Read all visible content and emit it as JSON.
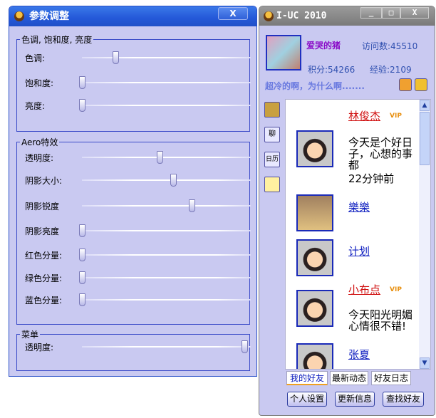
{
  "settings": {
    "title": "参数调整",
    "close": "X",
    "groups": [
      {
        "legend": "色调, 饱和度, 亮度",
        "sliders": [
          {
            "label": "色调:",
            "value": 0.2
          },
          {
            "label": "饱和度:",
            "value": 0
          },
          {
            "label": "亮度:",
            "value": 0
          }
        ]
      },
      {
        "legend": "Aero特效",
        "sliders": [
          {
            "label": "透明度:",
            "value": 0.46
          },
          {
            "label": "阴影大小:",
            "value": 0.54
          },
          {
            "label": "阴影锐度",
            "value": 0.65
          },
          {
            "label": "阴影亮度",
            "value": 0
          },
          {
            "label": "红色分量:",
            "value": 0
          },
          {
            "label": "绿色分量:",
            "value": 0
          },
          {
            "label": "蓝色分量:",
            "value": 0
          }
        ]
      },
      {
        "legend": "菜单",
        "sliders": [
          {
            "label": "透明度:",
            "value": 0.96
          }
        ]
      }
    ]
  },
  "main": {
    "title": "I-UC 2010",
    "minimize": "_",
    "maximize": "□",
    "close": "X",
    "username": "爱哭的猪",
    "visits": "访问数:45510",
    "points": "积分:54266",
    "exp": "经验:2109",
    "signature": "超冷的啊，为什么啊.......",
    "side_icons": [
      "聊",
      "日历"
    ],
    "friends": [
      {
        "name": "林俊杰",
        "vip": "VIP",
        "msg": "今天是个好日子，心想的事都",
        "time": "22分钟前"
      },
      {
        "name": "樂樂"
      },
      {
        "name": "计划"
      },
      {
        "name": "小布点",
        "vip": "VIP",
        "msg": "今天阳光明媚心情很不错!"
      },
      {
        "name": "张夏"
      }
    ],
    "tabs": [
      "我的好友",
      "最新动态",
      "好友日志"
    ],
    "buttons": [
      "个人设置",
      "更新信息",
      "查找好友"
    ]
  }
}
